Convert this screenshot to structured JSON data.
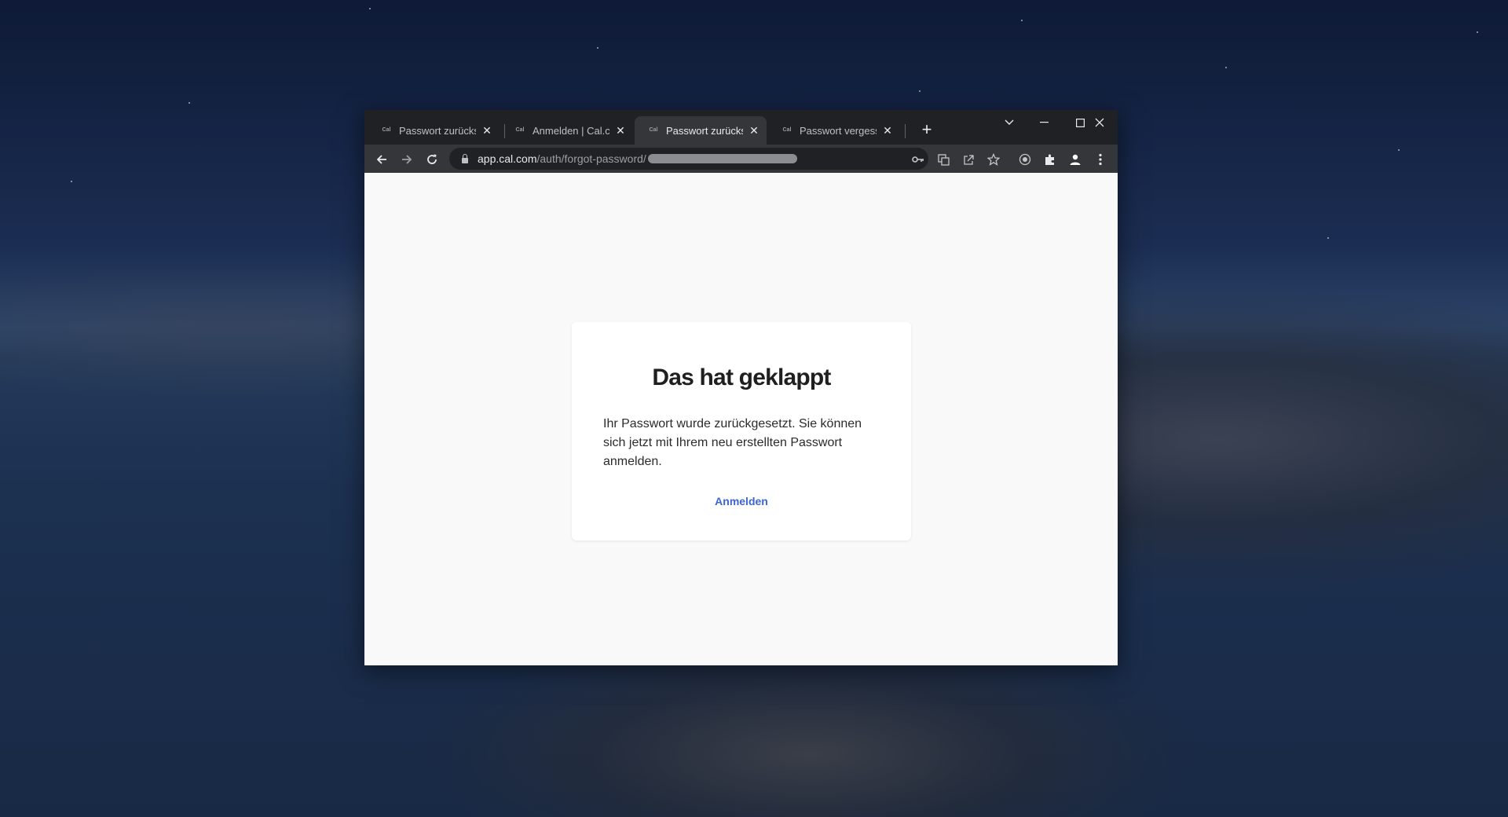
{
  "browser": {
    "tabs": [
      {
        "favicon": "Cal",
        "title": "Passwort zurücksetzen",
        "active": false
      },
      {
        "favicon": "Cal",
        "title": "Anmelden | Cal.com",
        "active": false
      },
      {
        "favicon": "Cal",
        "title": "Passwort zurücksetzen",
        "active": true
      },
      {
        "favicon": "Cal",
        "title": "Passwort vergessen",
        "active": false
      }
    ],
    "tab_close_glyph": "✕",
    "new_tab_glyph": "+",
    "address": {
      "host": "app.cal.com",
      "path": "/auth/forgot-password/"
    },
    "icons": {
      "back": "arrow-left-icon",
      "forward": "arrow-right-icon",
      "reload": "reload-icon",
      "password": "key-icon",
      "translate": "translate-icon",
      "share": "share-icon",
      "bookmark": "star-icon",
      "extension": "puzzle-icon",
      "profile": "person-icon",
      "menu": "kebab-menu-icon"
    }
  },
  "page": {
    "heading": "Das hat geklappt",
    "message": "Ihr Passwort wurde zurückgesetzt. Sie können sich jetzt mit Ihrem neu erstellten Passwort anmelden.",
    "link_label": "Anmelden",
    "link_color": "#3c66d6"
  }
}
